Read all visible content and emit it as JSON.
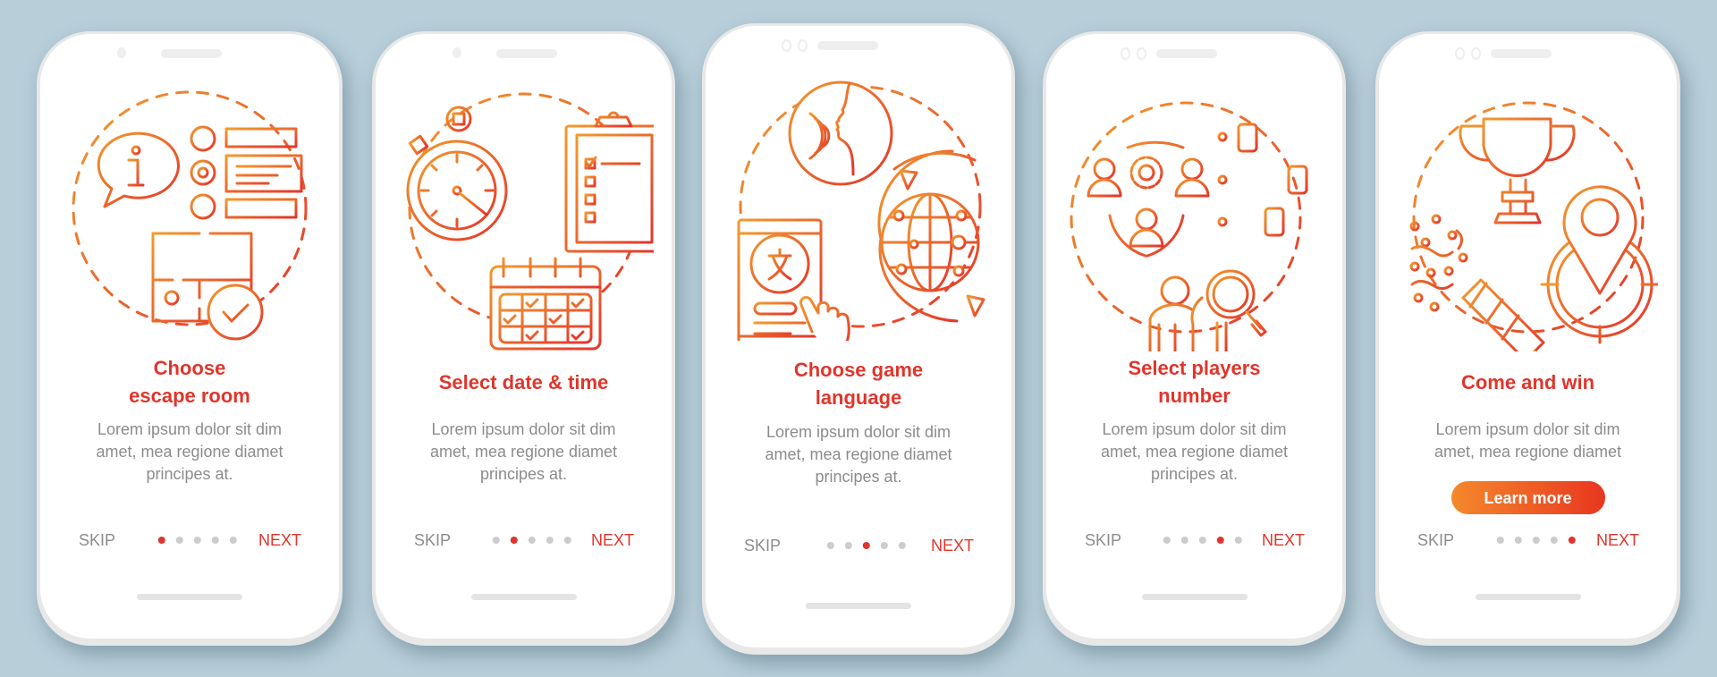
{
  "theme": {
    "background": "#b8cfda",
    "accent_red": "#e0352b",
    "accent_orange": "#f08a2c",
    "body_text": "#8c8c8c",
    "dot_inactive": "#cccccc"
  },
  "screens": [
    {
      "illustration": "escape-room-icon",
      "title_lines": [
        "Choose",
        "escape room"
      ],
      "body_lines": [
        "Lorem ipsum dolor sit dim",
        "amet, mea regione diamet",
        "principes at."
      ],
      "skip": "SKIP",
      "next": "NEXT",
      "active_dot": 1,
      "dot_count": 5
    },
    {
      "illustration": "date-time-icon",
      "title_lines": [
        "Select date & time"
      ],
      "body_lines": [
        "Lorem ipsum dolor sit dim",
        "amet, mea regione diamet",
        "principes at."
      ],
      "skip": "SKIP",
      "next": "NEXT",
      "active_dot": 2,
      "dot_count": 5
    },
    {
      "illustration": "game-language-icon",
      "title_lines": [
        "Choose game",
        "language"
      ],
      "body_lines": [
        "Lorem ipsum dolor sit dim",
        "amet, mea regione diamet",
        "principes at."
      ],
      "skip": "SKIP",
      "next": "NEXT",
      "active_dot": 3,
      "dot_count": 5
    },
    {
      "illustration": "players-number-icon",
      "title_lines": [
        "Select players",
        "number"
      ],
      "body_lines": [
        "Lorem ipsum dolor sit dim",
        "amet, mea regione diamet",
        "principes at."
      ],
      "skip": "SKIP",
      "next": "NEXT",
      "active_dot": 4,
      "dot_count": 5
    },
    {
      "illustration": "come-and-win-icon",
      "title_lines": [
        "Come and win"
      ],
      "body_lines": [
        "Lorem ipsum dolor sit dim",
        "amet, mea regione diamet"
      ],
      "button": "Learn more",
      "skip": "SKIP",
      "next": "NEXT",
      "active_dot": 5,
      "dot_count": 5
    }
  ]
}
